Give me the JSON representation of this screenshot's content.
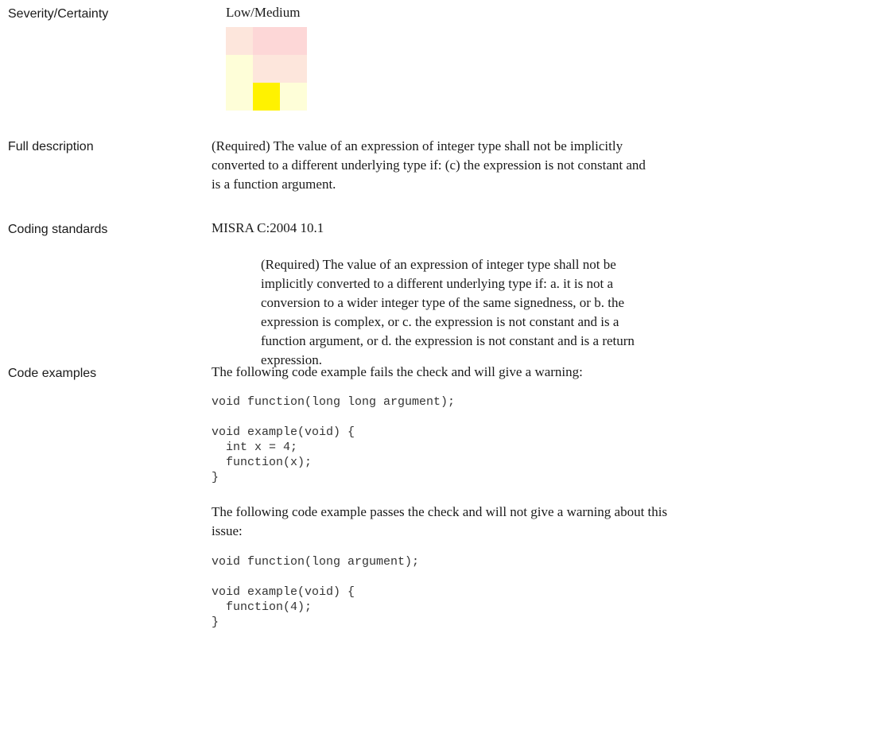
{
  "severity": {
    "label": "Severity/Certainty",
    "value": "Low/Medium",
    "matrix": {
      "rows": [
        [
          "#fde6dc",
          "#fdd7d7",
          "#fdd7d7"
        ],
        [
          "#fefed8",
          "#fde6dc",
          "#fde6dc"
        ],
        [
          "#fefed8",
          "#fff200",
          "#fefed8"
        ]
      ],
      "highlighted": {
        "row": 3,
        "col": 2
      }
    }
  },
  "full_description": {
    "label": "Full description",
    "text": "(Required) The value of an expression of integer type shall not be implicitly converted to a different underlying type if: (c) the expression is not constant and is a function argument."
  },
  "coding_standards": {
    "label": "Coding standards",
    "standard": "MISRA C:2004 10.1",
    "standard_text": "(Required) The value of an expression of integer type shall not be implicitly converted to a different underlying type if: a. it is not a conversion to a wider integer type of the same signedness, or b. the expression is complex, or c. the expression is not constant and is a function argument, or d. the expression is not constant and is a return expression."
  },
  "code_examples": {
    "label": "Code examples",
    "fail_intro": "The following code example fails the check and will give a warning:",
    "fail_code": [
      "void function(long long argument);",
      "",
      "void example(void) {",
      "  int x = 4;",
      "  function(x);",
      "}"
    ],
    "pass_intro": "The following code example passes the check and will not give a warning about this issue:",
    "pass_code": [
      "void function(long argument);",
      "",
      "void example(void) {",
      "  function(4);",
      "}"
    ]
  }
}
